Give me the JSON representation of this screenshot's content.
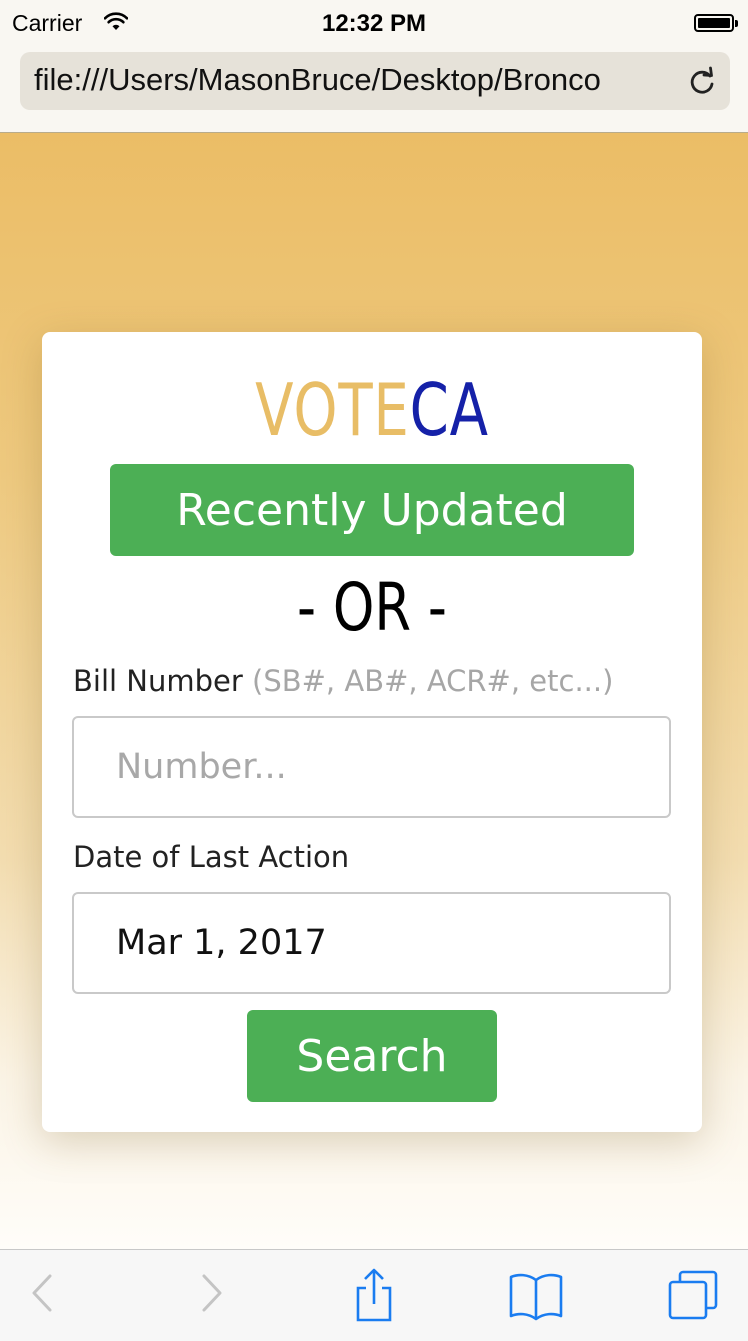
{
  "status_bar": {
    "carrier": "Carrier",
    "time": "12:32 PM"
  },
  "browser": {
    "url": "file:///Users/MasonBruce/Desktop/Bronco"
  },
  "app": {
    "logo_vote": "VOTE",
    "logo_ca": "CA",
    "recently_updated_label": "Recently Updated",
    "or_separator": "- OR -",
    "bill_number_label": "Bill Number",
    "bill_number_hint": "(SB#, AB#, ACR#, etc...)",
    "bill_number_placeholder": "Number...",
    "date_label": "Date of Last Action",
    "date_value": "Mar 1, 2017",
    "search_label": "Search"
  },
  "colors": {
    "accent_gold": "#e8bd66",
    "accent_blue": "#1521a8",
    "button_green": "#4caf55",
    "ios_blue": "#1a7cf0"
  },
  "toolbar": {
    "icons": [
      "back-icon",
      "forward-icon",
      "share-icon",
      "bookmarks-icon",
      "tabs-icon"
    ]
  }
}
